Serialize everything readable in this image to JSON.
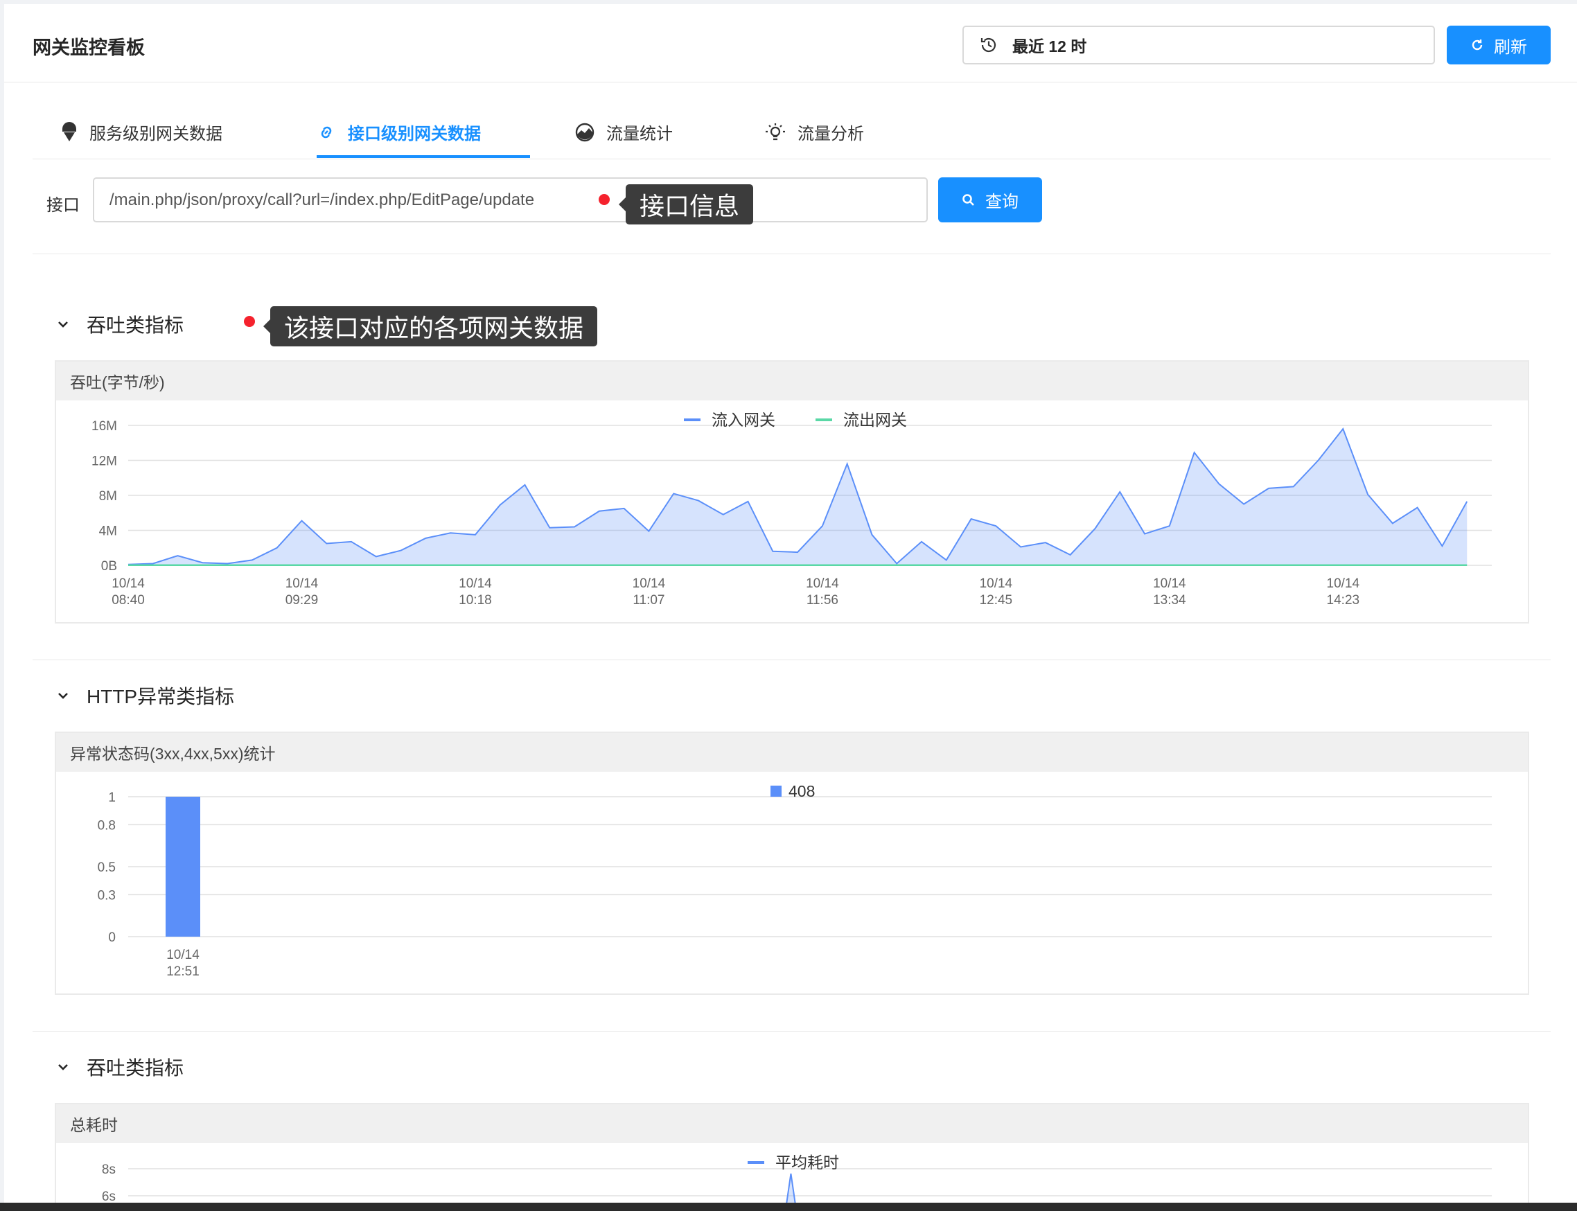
{
  "header": {
    "title": "网关监控看板",
    "time_range": "最近 12 时",
    "refresh_label": "刷新"
  },
  "tabs": [
    {
      "label": "服务级别网关数据"
    },
    {
      "label": "接口级别网关数据"
    },
    {
      "label": "流量统计"
    },
    {
      "label": "流量分析"
    }
  ],
  "search": {
    "label": "接口",
    "value": "/main.php/json/proxy/call?url=/index.php/EditPage/update",
    "button_label": "查询"
  },
  "annotations": {
    "interface_info": "接口信息",
    "gateway_data": "该接口对应的各项网关数据"
  },
  "sections": [
    {
      "title": "吞吐类指标",
      "card_title": "吞吐(字节/秒)"
    },
    {
      "title": "HTTP异常类指标",
      "card_title": "异常状态码(3xx,4xx,5xx)统计"
    },
    {
      "title": "吞吐类指标",
      "card_title": "总耗时"
    }
  ],
  "colors": {
    "primary": "#1890ff",
    "series_in": "#5b8ff9",
    "series_out": "#5ad8a6",
    "annotation_dot": "#f5222d"
  },
  "chart_data": [
    {
      "type": "area",
      "legend": [
        "流入网关",
        "流出网关"
      ],
      "legend_position": "top-center",
      "yticks": [
        "0B",
        "4M",
        "8M",
        "12M",
        "16M"
      ],
      "ylim": [
        0,
        16
      ],
      "xlim": [
        0,
        55
      ],
      "xticks": [
        {
          "i": 0,
          "date": "10/14",
          "time": "08:40"
        },
        {
          "i": 7,
          "date": "10/14",
          "time": "09:29"
        },
        {
          "i": 14,
          "date": "10/14",
          "time": "10:18"
        },
        {
          "i": 21,
          "date": "10/14",
          "time": "11:07"
        },
        {
          "i": 28,
          "date": "10/14",
          "time": "11:56"
        },
        {
          "i": 35,
          "date": "10/14",
          "time": "12:45"
        },
        {
          "i": 42,
          "date": "10/14",
          "time": "13:34"
        },
        {
          "i": 49,
          "date": "10/14",
          "time": "14:23"
        }
      ],
      "series": [
        {
          "name": "流入网关",
          "values": [
            0.1,
            0.2,
            1.1,
            0.3,
            0.2,
            0.6,
            2.0,
            5.1,
            2.5,
            2.7,
            1.0,
            1.7,
            3.1,
            3.7,
            3.5,
            6.9,
            9.2,
            4.3,
            4.4,
            6.2,
            6.5,
            3.9,
            8.2,
            7.4,
            5.8,
            7.3,
            1.6,
            1.5,
            4.5,
            11.6,
            3.5,
            0.2,
            2.7,
            0.6,
            5.3,
            4.5,
            2.1,
            2.6,
            1.2,
            4.2,
            8.4,
            3.6,
            4.5,
            12.9,
            9.3,
            7.0,
            8.8,
            9.0,
            12.0,
            15.6,
            8.1,
            4.8,
            6.6,
            2.2,
            7.3
          ]
        },
        {
          "name": "流出网关",
          "values": [
            0.02,
            0.02,
            0.02,
            0.02,
            0.02,
            0.02,
            0.02,
            0.02,
            0.02,
            0.02,
            0.02,
            0.02,
            0.02,
            0.02,
            0.02,
            0.02,
            0.02,
            0.02,
            0.02,
            0.02,
            0.02,
            0.02,
            0.02,
            0.02,
            0.02,
            0.02,
            0.02,
            0.02,
            0.02,
            0.02,
            0.02,
            0.02,
            0.02,
            0.02,
            0.02,
            0.02,
            0.02,
            0.02,
            0.02,
            0.02,
            0.02,
            0.02,
            0.02,
            0.02,
            0.02,
            0.02,
            0.02,
            0.02,
            0.02,
            0.02,
            0.02,
            0.02,
            0.02,
            0.02,
            0.02
          ]
        }
      ]
    },
    {
      "type": "bar",
      "legend": [
        "408"
      ],
      "legend_position": "top-center",
      "yticks": [
        "0",
        "0.3",
        "0.5",
        "0.8",
        "1"
      ],
      "ytick_values": [
        0,
        0.3,
        0.5,
        0.8,
        1
      ],
      "ylim": [
        0,
        1
      ],
      "categories": [
        {
          "date": "10/14",
          "time": "12:51"
        }
      ],
      "series": [
        {
          "name": "408",
          "values": [
            1
          ]
        }
      ]
    },
    {
      "type": "line",
      "legend": [
        "平均耗时"
      ],
      "legend_position": "top-center",
      "yticks": [
        "8s",
        "6s"
      ],
      "ytick_values": [
        8,
        6
      ],
      "peak_fraction": 0.486
    }
  ]
}
